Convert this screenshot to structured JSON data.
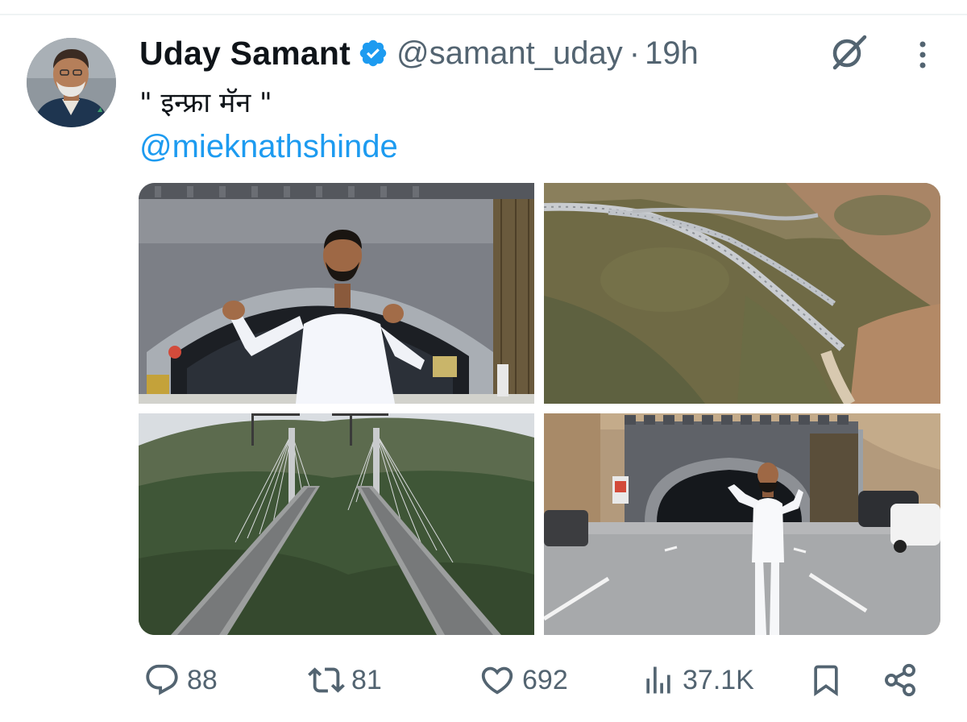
{
  "tweet": {
    "author_name": "Uday Samant",
    "handle": "@samant_uday",
    "separator": "·",
    "time": "19h",
    "text": "\" इन्फ्रा मॅन \"",
    "mention": "@mieknathshinde",
    "verified": true
  },
  "colors": {
    "accent": "#1d9bf0",
    "secondary_text": "#536471",
    "primary_text": "#0f1419",
    "divider": "#eff3f4"
  },
  "media": {
    "photos": [
      {
        "subject": "man in white gesturing in front of tunnel entrance"
      },
      {
        "subject": "aerial view of highway viaduct through hills"
      },
      {
        "subject": "cable-stayed bridge over forested valley"
      },
      {
        "subject": "man in white standing on road before tunnel portal"
      }
    ]
  },
  "actions": {
    "replies": "88",
    "reposts": "81",
    "likes": "692",
    "views": "37.1K",
    "icons": [
      "reply-icon",
      "repost-icon",
      "like-icon",
      "views-icon",
      "bookmark-icon",
      "share-icon"
    ]
  }
}
